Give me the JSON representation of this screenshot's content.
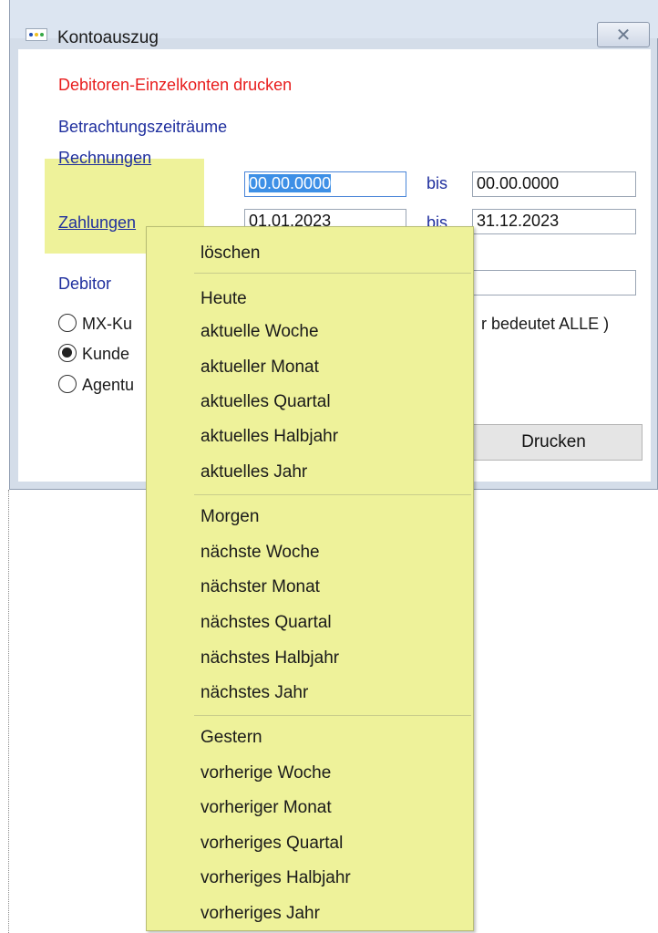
{
  "window": {
    "title": "Kontoauszug",
    "close_icon": "close-icon"
  },
  "content": {
    "heading": "Debitoren-Einzelkonten drucken",
    "subheading": "Betrachtungszeiträume",
    "rows": [
      {
        "label": "Rechnungen",
        "from": "00.00.0000",
        "bis": "bis",
        "to": "00.00.0000"
      },
      {
        "label": "Zahlungen",
        "from": "01.01.2023",
        "bis": "bis",
        "to": "31.12.2023"
      }
    ],
    "debitor_label": "Debitor",
    "debitor_value": "",
    "hint": "r bedeutet ALLE )",
    "radios": [
      {
        "label": "MX-Ku",
        "selected": false
      },
      {
        "label": "Kunde",
        "selected": true
      },
      {
        "label": "Agentu",
        "selected": false
      }
    ],
    "print_button": "Drucken"
  },
  "menu": {
    "items": [
      "löschen",
      "Heute",
      "aktuelle Woche",
      "aktueller Monat",
      "aktuelles Quartal",
      "aktuelles Halbjahr",
      "aktuelles Jahr",
      "Morgen",
      "nächste Woche",
      "nächster Monat",
      "nächstes Quartal",
      "nächstes Halbjahr",
      "nächstes Jahr",
      "Gestern",
      "vorherige Woche",
      "vorheriger Monat",
      "vorheriges Quartal",
      "vorheriges Halbjahr",
      "vorheriges Jahr"
    ]
  },
  "colors": {
    "heading": "#e81d1d",
    "label": "#1f2f9e",
    "highlight": "#eef29a",
    "selection": "#3d8fe6"
  }
}
